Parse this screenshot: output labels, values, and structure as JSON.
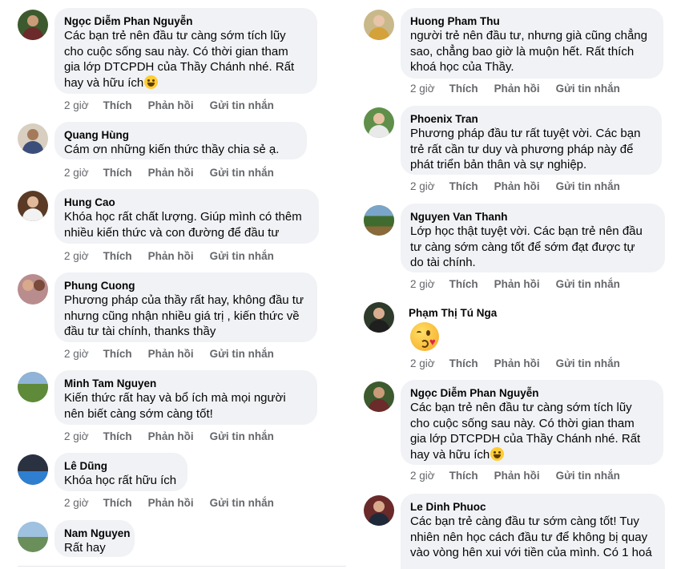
{
  "left": [
    {
      "author": "Ngọc Diễm Phan Nguyễn",
      "text": "Các bạn trẻ nên đầu tư càng sớm tích lũy\ncho cuộc sống sau này. Có thời gian tham\ngia lớp DTCPDH của Thầy Chánh nhé. Rất\nhay và hữu ích",
      "time": "2 giờ",
      "like": "Thích",
      "reply": "Phản hồi",
      "message": "Gửi tin nhắn",
      "avatar": "avatar-photo-man-outdoor"
    },
    {
      "author": "Quang Hùng",
      "text": "Cám ơn những kiến thức thầy chia sẻ ạ.",
      "time": "2 giờ",
      "like": "Thích",
      "reply": "Phản hồi",
      "message": "Gửi tin nhắn",
      "avatar": "avatar-photo-group"
    },
    {
      "author": "Hung Cao",
      "text": "Khóa học rất chất lượng. Giúp mình có thêm\nnhiều kiến thức và con đường để đầu tư",
      "time": "2 giờ",
      "like": "Thích",
      "reply": "Phản hồi",
      "message": "Gửi tin nhắn",
      "avatar": "avatar-photo-chef"
    },
    {
      "author": "Phung Cuong",
      "text": "Phương pháp của thầy rất hay, không đầu tư\nnhưng cũng nhận nhiều giá trị , kiến thức về\nđầu tư tài chính, thanks thầy",
      "time": "2 giờ",
      "like": "Thích",
      "reply": "Phản hồi",
      "message": "Gửi tin nhắn",
      "avatar": "avatar-photo-couple"
    },
    {
      "author": "Minh Tam Nguyen",
      "text": "Kiến thức rất hay và bổ ích mà mọi người\nnên biết càng sớm càng tốt!",
      "time": "2 giờ",
      "like": "Thích",
      "reply": "Phản hồi",
      "message": "Gửi tin nhắn",
      "avatar": "avatar-photo-landscape"
    },
    {
      "author": "Lê Dũng",
      "text": "Khóa học rất hữu ích",
      "time": "2 giờ",
      "like": "Thích",
      "reply": "Phản hồi",
      "message": "Gửi tin nhắn",
      "avatar": "avatar-photo-car"
    },
    {
      "author": "Nam Nguyen",
      "text": "Rất hay",
      "avatar": "avatar-photo-road"
    }
  ],
  "right": [
    {
      "author": "Huong Pham Thu",
      "text": "người trẻ nên đầu tư, nhưng già cũng chẳng\nsao, chẳng bao giờ là muộn hết.  Rất thích\nkhoá học của Thầy.",
      "time": "2 giờ",
      "like": "Thích",
      "reply": "Phản hồi",
      "message": "Gửi tin nhắn",
      "avatar": "avatar-photo-woman"
    },
    {
      "author": "Phoenix Tran",
      "text": "Phương pháp đầu tư rất tuyệt vời. Các bạn\ntrẻ rất cần tư duy và phương pháp này để\nphát triển bản thân và sự nghiệp.",
      "time": "2 giờ",
      "like": "Thích",
      "reply": "Phản hồi",
      "message": "Gửi tin nhắn",
      "avatar": "avatar-photo-woman-garden"
    },
    {
      "author": "Nguyen Van Thanh",
      "text": "Lớp học thật tuyệt vời. Các bạn trẻ nên đầu\ntư càng sớm càng tốt để sớm đạt được tự\ndo tài chính.",
      "time": "2 giờ",
      "like": "Thích",
      "reply": "Phản hồi",
      "message": "Gửi tin nhắn",
      "avatar": "avatar-photo-scenery"
    },
    {
      "author": "Phạm Thị Tú Nga",
      "sticker": "kissing-face-heart-emoji",
      "time": "2 giờ",
      "like": "Thích",
      "reply": "Phản hồi",
      "message": "Gửi tin nhắn",
      "avatar": "avatar-photo-woman-dark"
    },
    {
      "author": "Ngọc Diễm Phan Nguyễn",
      "text": "Các bạn trẻ nên đầu tư càng sớm tích lũy\ncho cuộc sống sau này. Có thời gian tham\ngia lớp DTCPDH của Thầy Chánh nhé. Rất\nhay và hữu ích",
      "time": "2 giờ",
      "like": "Thích",
      "reply": "Phản hồi",
      "message": "Gửi tin nhắn",
      "avatar": "avatar-photo-man-outdoor"
    },
    {
      "author": "Le Dinh Phuoc",
      "text": "Các bạn trẻ càng đầu tư sớm càng tốt! Tuy\nnhiên nên học cách đầu tư để không bị quay\nvào vòng hên xui với tiền của mình. Có 1 hoá",
      "avatar": "avatar-photo-man-suit"
    }
  ],
  "colors": {
    "bubble": "#f0f2f5",
    "meta": "#65676b",
    "text": "#050505"
  }
}
